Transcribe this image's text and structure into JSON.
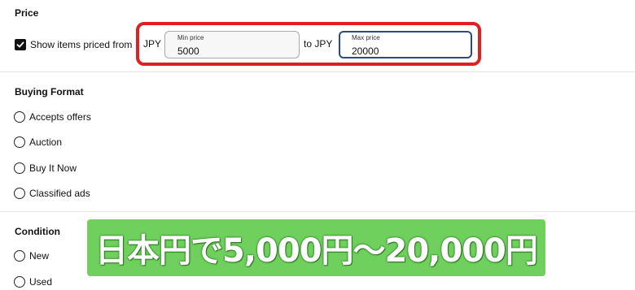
{
  "price": {
    "title": "Price",
    "checkbox_label": "Show items priced from",
    "checked": true,
    "currency_from": "JPY",
    "to_label": "to JPY",
    "min": {
      "label": "Min price",
      "value": "5000"
    },
    "max": {
      "label": "Max price",
      "value": "20000"
    }
  },
  "buying_format": {
    "title": "Buying Format",
    "options": [
      {
        "label": "Accepts offers"
      },
      {
        "label": "Auction"
      },
      {
        "label": "Buy It Now"
      },
      {
        "label": "Classified ads"
      }
    ]
  },
  "condition": {
    "title": "Condition",
    "options": [
      {
        "label": "New"
      },
      {
        "label": "Used"
      }
    ]
  },
  "caption": {
    "text": "日本円で5,000円～20,000円"
  },
  "colors": {
    "highlight": "#e02020",
    "caption_bg": "#6fd05e",
    "focus_border": "#2c4a80"
  }
}
